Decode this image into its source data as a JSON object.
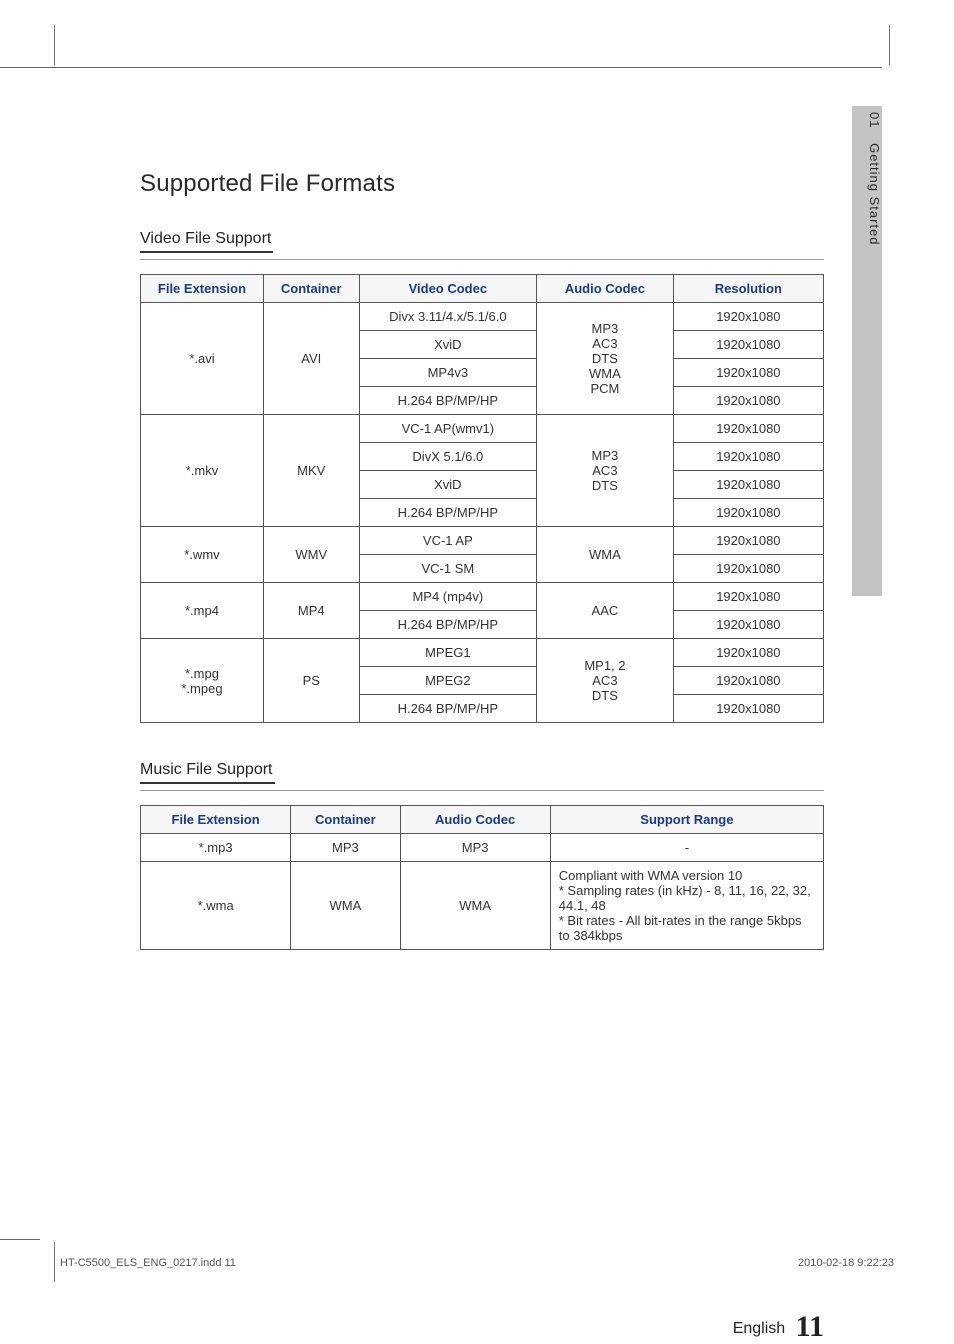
{
  "side_tab": {
    "chapter": "01",
    "label": "Getting Started"
  },
  "title": "Supported File Formats",
  "video_section": {
    "heading": "Video File Support",
    "headers": [
      "File Extension",
      "Container",
      "Video Codec",
      "Audio Codec",
      "Resolution"
    ],
    "groups": [
      {
        "ext": "*.avi",
        "container": "AVI",
        "audio": "MP3\nAC3\nDTS\nWMA\nPCM",
        "rows": [
          {
            "vcodec": "Divx 3.11/4.x/5.1/6.0",
            "res": "1920x1080"
          },
          {
            "vcodec": "XviD",
            "res": "1920x1080"
          },
          {
            "vcodec": "MP4v3",
            "res": "1920x1080"
          },
          {
            "vcodec": "H.264 BP/MP/HP",
            "res": "1920x1080"
          }
        ]
      },
      {
        "ext": "*.mkv",
        "container": "MKV",
        "audio": "MP3\nAC3\nDTS",
        "rows": [
          {
            "vcodec": "VC-1 AP(wmv1)",
            "res": "1920x1080"
          },
          {
            "vcodec": "DivX 5.1/6.0",
            "res": "1920x1080"
          },
          {
            "vcodec": "XviD",
            "res": "1920x1080"
          },
          {
            "vcodec": "H.264 BP/MP/HP",
            "res": "1920x1080"
          }
        ]
      },
      {
        "ext": "*.wmv",
        "container": "WMV",
        "audio": "WMA",
        "rows": [
          {
            "vcodec": "VC-1 AP",
            "res": "1920x1080"
          },
          {
            "vcodec": "VC-1 SM",
            "res": "1920x1080"
          }
        ]
      },
      {
        "ext": "*.mp4",
        "container": "MP4",
        "audio": "AAC",
        "rows": [
          {
            "vcodec": "MP4 (mp4v)",
            "res": "1920x1080"
          },
          {
            "vcodec": "H.264 BP/MP/HP",
            "res": "1920x1080"
          }
        ]
      },
      {
        "ext": "*.mpg\n*.mpeg",
        "container": "PS",
        "audio": "MP1, 2\nAC3\nDTS",
        "rows": [
          {
            "vcodec": "MPEG1",
            "res": "1920x1080"
          },
          {
            "vcodec": "MPEG2",
            "res": "1920x1080"
          },
          {
            "vcodec": "H.264 BP/MP/HP",
            "res": "1920x1080"
          }
        ]
      }
    ]
  },
  "music_section": {
    "heading": "Music File Support",
    "headers": [
      "File Extension",
      "Container",
      "Audio Codec",
      "Support Range"
    ],
    "rows": [
      {
        "ext": "*.mp3",
        "container": "MP3",
        "acodec": "MP3",
        "range": "-"
      },
      {
        "ext": "*.wma",
        "container": "WMA",
        "acodec": "WMA",
        "range": "Compliant with WMA version 10\n* Sampling rates (in kHz) - 8, 11, 16, 22, 32, 44.1, 48\n* Bit rates - All bit-rates in the range 5kbps to 384kbps"
      }
    ]
  },
  "footer": {
    "lang": "English",
    "page": "11",
    "file": "HT-C5500_ELS_ENG_0217.indd   11",
    "timestamp": "2010-02-18   9:22:23"
  }
}
